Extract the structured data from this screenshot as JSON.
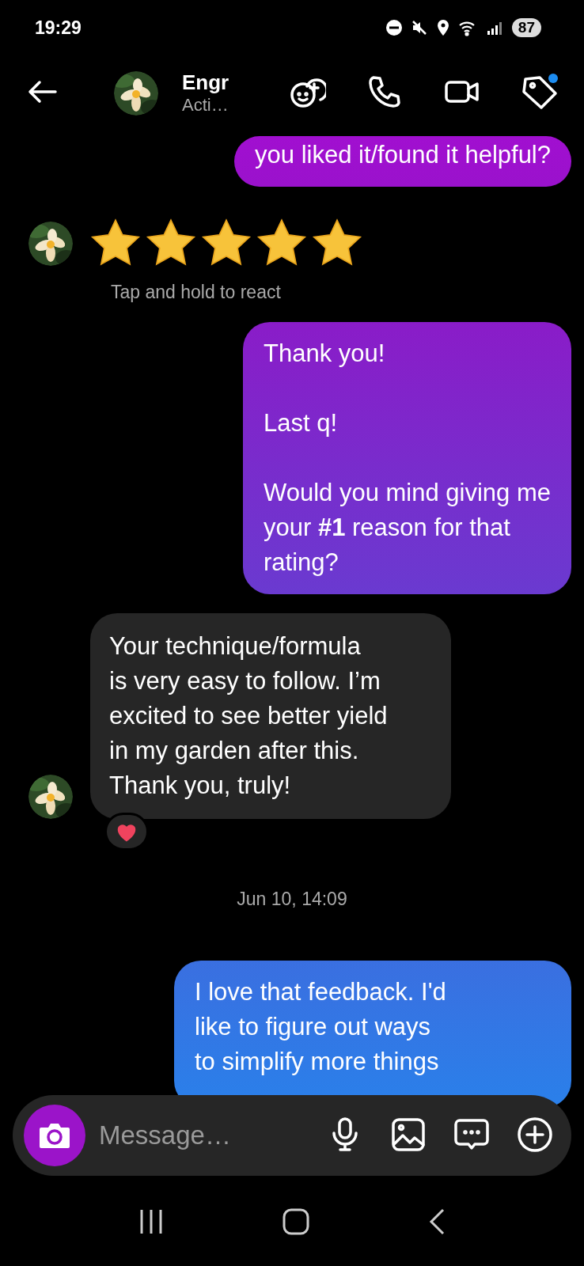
{
  "status_bar": {
    "time": "19:29",
    "battery": "87"
  },
  "header": {
    "name": "Engr",
    "status": "Acti…"
  },
  "messages": [
    {
      "kind": "outgoing",
      "text": "you liked it/found it helpful?"
    },
    {
      "kind": "stars",
      "stars": 5
    },
    {
      "kind": "hint",
      "text": "Tap and hold to react"
    },
    {
      "kind": "outgoing",
      "text": "Thank you!\n\nLast q!\n\nWould you mind giving me\nyour **#1** reason for that\nrating?"
    },
    {
      "kind": "incoming",
      "text": "Your technique/formula\nis very easy to follow. I’m\nexcited to see better yield\nin my garden after this.\nThank you, truly!",
      "reaction": true
    },
    {
      "kind": "timestamp",
      "text": "Jun 10, 14:09"
    },
    {
      "kind": "outgoing",
      "text": "I love that feedback. I'd\nlike to figure out ways\nto simplify more things"
    }
  ],
  "composer": {
    "placeholder": "Message…"
  }
}
